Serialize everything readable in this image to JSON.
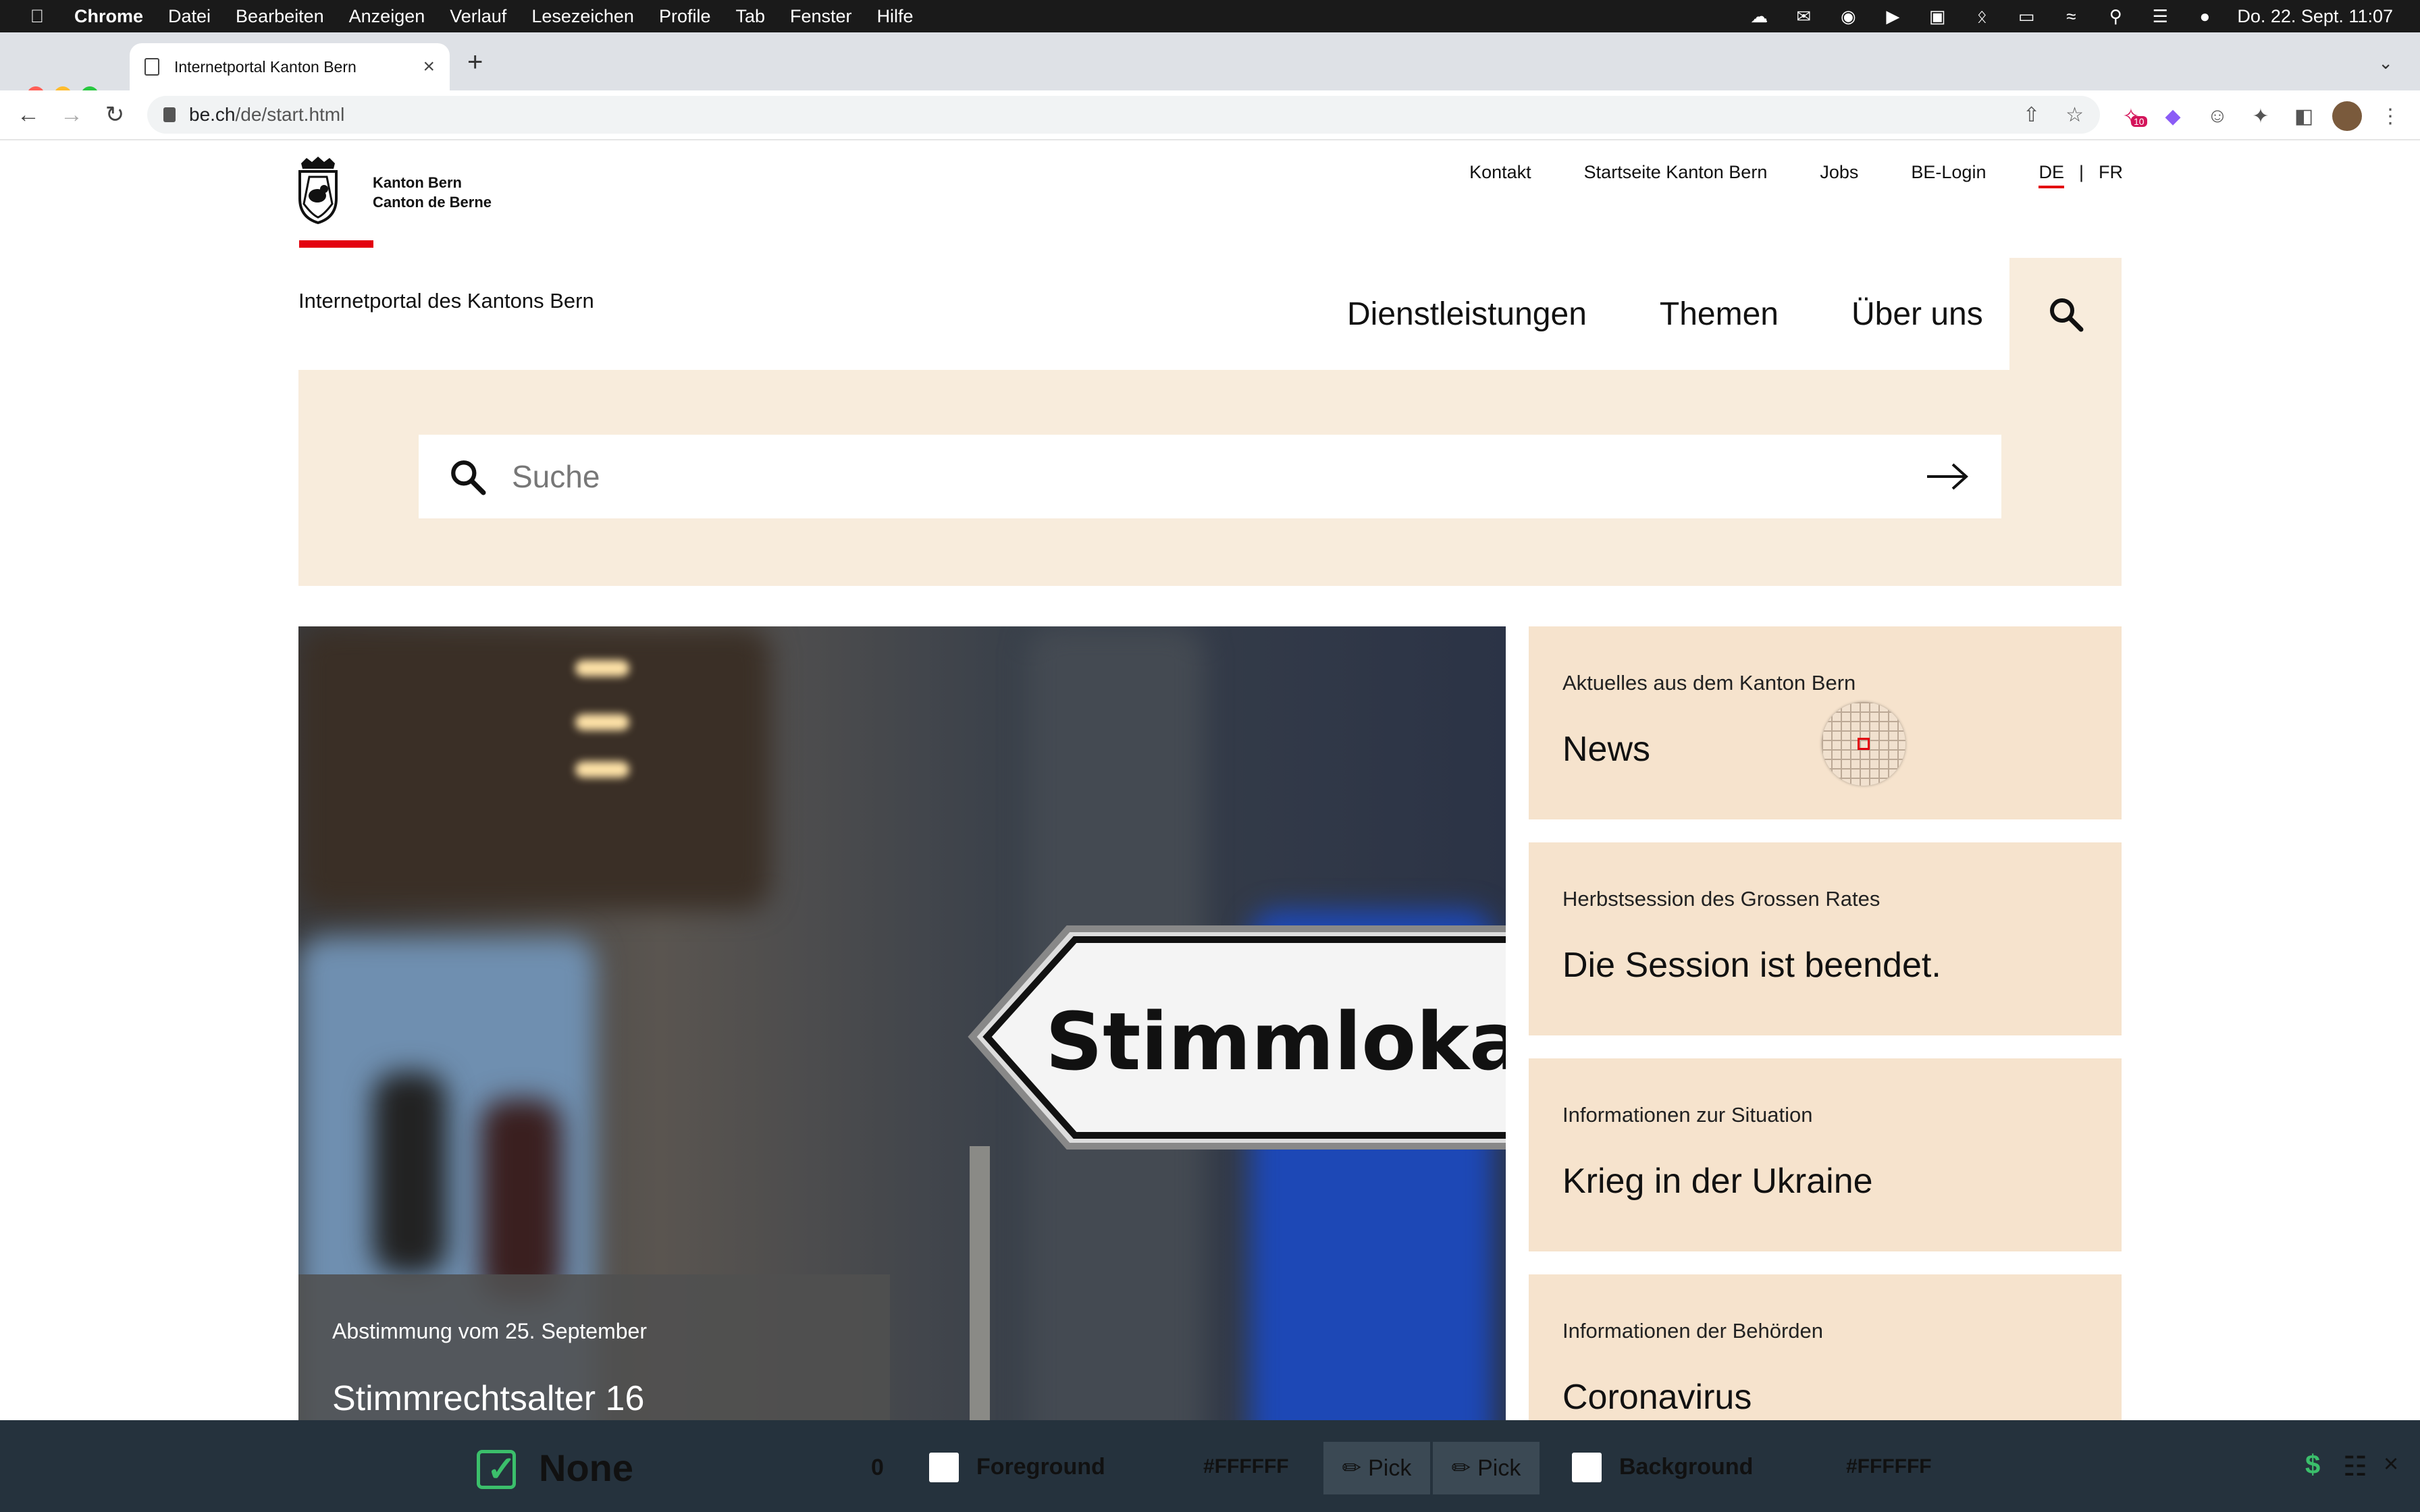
{
  "menubar": {
    "app": "Chrome",
    "items": [
      "Datei",
      "Bearbeiten",
      "Anzeigen",
      "Verlauf",
      "Lesezeichen",
      "Profile",
      "Tab",
      "Fenster",
      "Hilfe"
    ],
    "clock": "Do. 22. Sept.  11:07",
    "icons": [
      "cloud-icon",
      "mail-icon",
      "record-icon",
      "play-icon",
      "window-icon",
      "bluetooth-icon",
      "battery-icon",
      "wifi-icon",
      "spotlight-icon",
      "control-center-icon",
      "siri-icon"
    ]
  },
  "browser": {
    "tab_title": "Internetportal Kanton Bern",
    "url_host": "be.ch",
    "url_path": "/de/start.html",
    "extension_badge": "10"
  },
  "site": {
    "logo_line1": "Kanton Bern",
    "logo_line2": "Canton de Berne",
    "topnav": [
      "Kontakt",
      "Startseite Kanton Bern",
      "Jobs",
      "BE-Login"
    ],
    "lang_active": "DE",
    "lang_sep": "|",
    "lang_other": "FR",
    "portal_title": "Internetportal des Kantons Bern",
    "mainnav": [
      "Dienstleistungen",
      "Themen",
      "Über uns"
    ],
    "search_placeholder": "Suche",
    "hero": {
      "sign_text": "Stimmlokal",
      "kicker": "Abstimmung vom 25. September",
      "title": "Stimmrechtsalter 16"
    },
    "cards": [
      {
        "kicker": "Aktuelles aus dem Kanton Bern",
        "title": "News"
      },
      {
        "kicker": "Herbstsession des Grossen Rates",
        "title": "Die Session ist beendet."
      },
      {
        "kicker": "Informationen zur Situation",
        "title": "Krieg in der Ukraine"
      },
      {
        "kicker": "Informationen der Behörden",
        "title": "Coronavirus"
      }
    ]
  },
  "contrast_tool": {
    "result": "None",
    "ratio": "0",
    "foreground_label": "Foreground",
    "foreground_hex": "#FFFFFF",
    "pick_label": "Pick",
    "background_label": "Background",
    "background_hex": "#FFFFFF"
  },
  "colors": {
    "accent_red": "#e3000f",
    "beige": "#f8ecdc",
    "card_beige": "#f6e3cd",
    "toolbar_dark": "#25323d",
    "pass_green": "#3bbf6b"
  }
}
